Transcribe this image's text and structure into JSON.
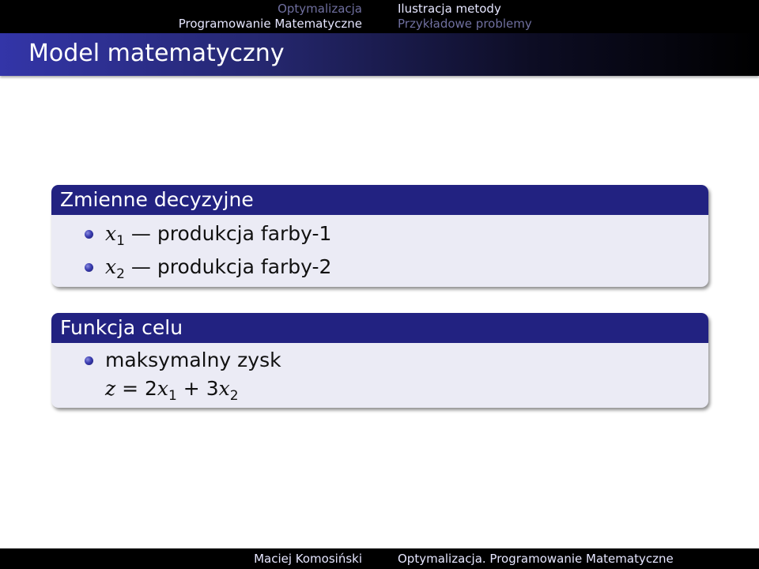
{
  "nav": {
    "left": [
      "Optymalizacja",
      "Programowanie Matematyczne"
    ],
    "right": [
      "Ilustracja metody",
      "Przykładowe problemy"
    ]
  },
  "frame": {
    "title": "Model matematyczny"
  },
  "blocks": [
    {
      "title": "Zmienne decyzyjne",
      "items": [
        {
          "var": "x",
          "sub": "1",
          "text": "produkcja farby-1"
        },
        {
          "var": "x",
          "sub": "2",
          "text": "produkcja farby-2"
        }
      ]
    },
    {
      "title": "Funkcja celu",
      "items": [
        {
          "text": "maksymalny zysk"
        }
      ],
      "formula": {
        "lhs": "z",
        "eq": " = 2",
        "v1": "x",
        "s1": "1",
        "plus": " + 3",
        "v2": "x",
        "s2": "2"
      }
    }
  ],
  "footer": {
    "author": "Maciej Komosiński",
    "title": "Optymalizacja. Programowanie Matematyczne"
  },
  "colors": {
    "nav_bg": "#000000",
    "title_gradient_start": "#3335a8",
    "block_head": "#222281",
    "block_body": "#ebebf5"
  }
}
